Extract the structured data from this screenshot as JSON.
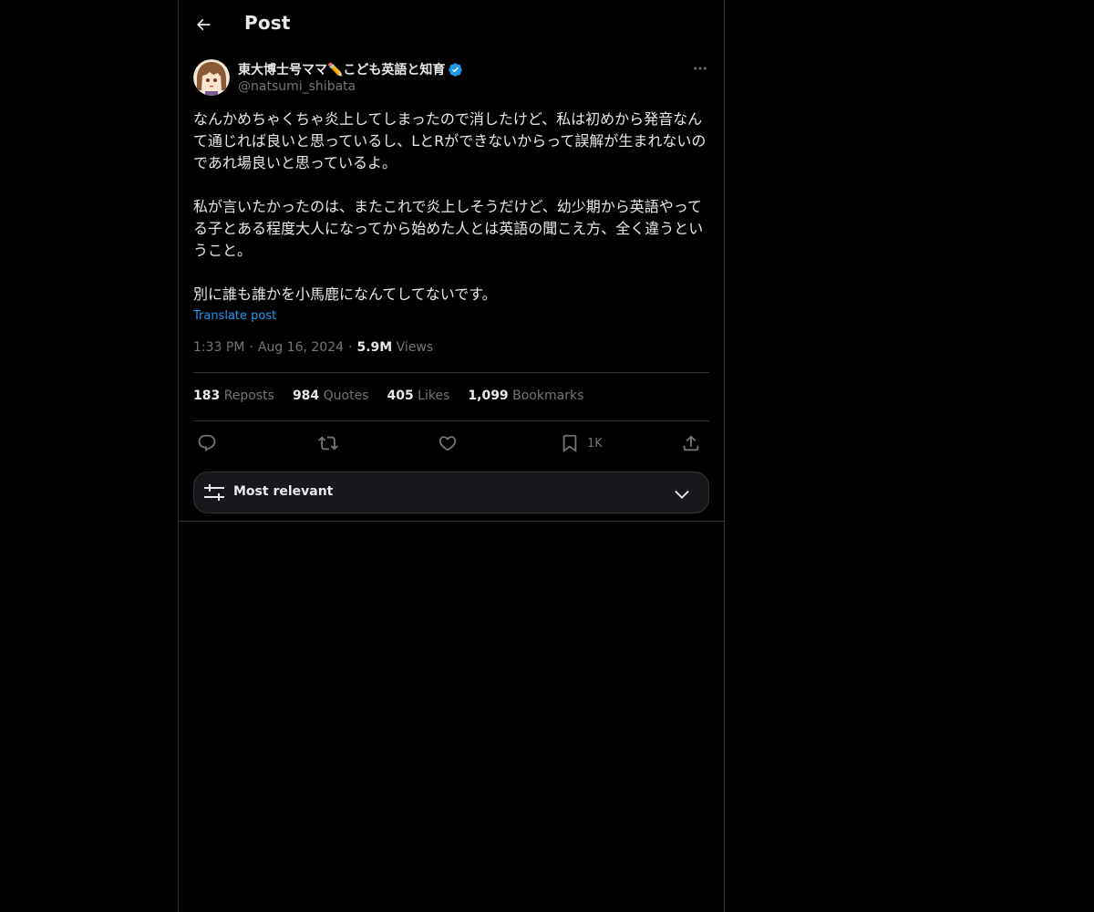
{
  "header": {
    "title": "Post",
    "back_icon": "arrow-left-icon"
  },
  "author": {
    "display_name": "東大博士号ママ✏️こども英語と知育",
    "handle": "@natsumi_shibata",
    "verified_icon": "verified-badge-icon",
    "more_icon": "more-horizontal-icon"
  },
  "post": {
    "paragraph_1": "なんかめちゃくちゃ炎上してしまったので消したけど、私は初めから発音なんて通じれば良いと思っているし、LとRができないからって誤解が生まれないのであれ場良いと思っているよ。",
    "paragraph_2": "私が言いたかったのは、またこれで炎上しそうだけど、幼少期から英語やってる子とある程度大人になってから始めた人とは英語の聞こえ方、全く違うということ。",
    "paragraph_3": "別に誰も誰かを小馬鹿になんてしてないです。",
    "translate_label": "Translate post"
  },
  "meta": {
    "time": "1:33 PM",
    "date": "Aug 16, 2024",
    "separator": "·",
    "views_count": "5.9M",
    "views_label": "Views"
  },
  "stats": {
    "reposts_count": "183",
    "reposts_label": "Reposts",
    "quotes_count": "984",
    "quotes_label": "Quotes",
    "likes_count": "405",
    "likes_label": "Likes",
    "bookmarks_count": "1,099",
    "bookmarks_label": "Bookmarks"
  },
  "actions": {
    "bookmark_count": "1K"
  },
  "sort": {
    "label": "Most relevant"
  },
  "colors": {
    "background": "#000000",
    "text": "#e7e9ea",
    "muted": "#71767b",
    "accent": "#1d9bf0",
    "border": "#2f3336"
  }
}
